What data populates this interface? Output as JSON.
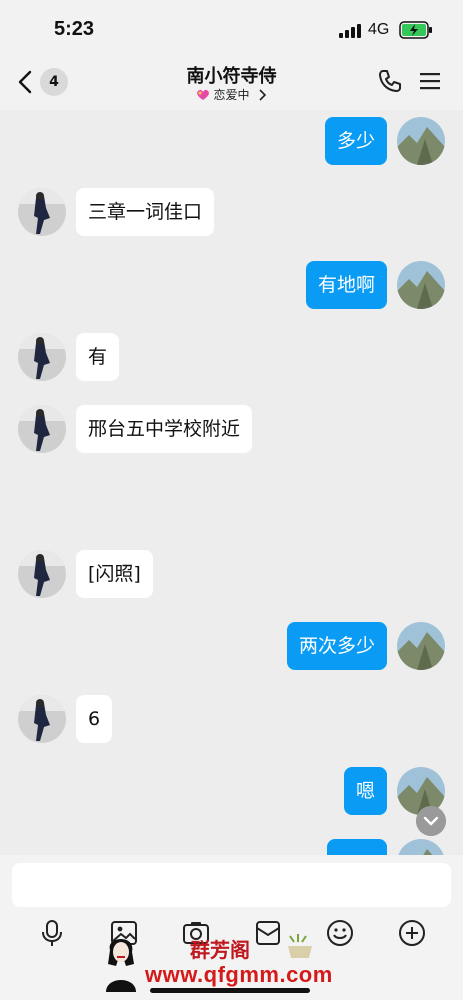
{
  "status_bar": {
    "time": "5:23",
    "network": "4G"
  },
  "header": {
    "unread_count": "4",
    "chat_name": "南小符寺侍",
    "relationship_status": "恋爱中"
  },
  "messages": [
    {
      "side": "out",
      "text": "多少"
    },
    {
      "side": "in",
      "text": "三章一词佳口"
    },
    {
      "side": "out",
      "text": "有地啊"
    },
    {
      "side": "in",
      "text": "有"
    },
    {
      "side": "in",
      "text": "邢台五中学校附近"
    },
    {
      "side": "in",
      "text": "[闪照]"
    },
    {
      "side": "out",
      "text": "两次多少"
    },
    {
      "side": "in",
      "text": "6"
    },
    {
      "side": "out",
      "text": "嗯"
    },
    {
      "side": "out",
      "text": ""
    }
  ],
  "input": {
    "value": "",
    "placeholder": ""
  },
  "toolbar": [
    "mic-icon",
    "image-icon",
    "camera-icon",
    "red-packet-icon",
    "emoji-icon",
    "plus-icon"
  ],
  "watermark": {
    "title": "群芳阁",
    "url": "www.qfgmm.com"
  },
  "colors": {
    "outgoing_bubble": "#0a9bf5",
    "incoming_bubble": "#ffffff",
    "background": "#ededed"
  }
}
